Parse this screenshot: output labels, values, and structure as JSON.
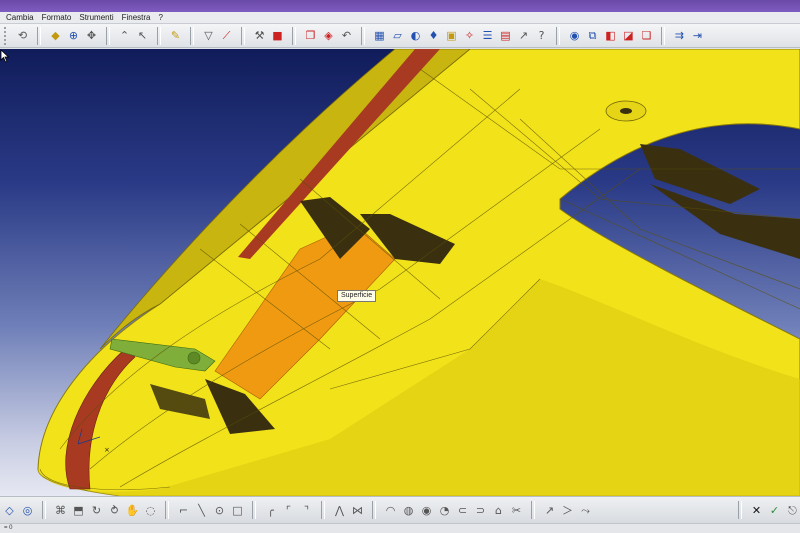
{
  "menu": {
    "items": [
      "Cambia",
      "Formato",
      "Strumenti",
      "Finestra",
      "?"
    ]
  },
  "viewport": {
    "tooltip": "Superficie",
    "colors": {
      "part_surface": "#f2e21a",
      "part_edge": "#b8a810",
      "selected_face": "#f09a12",
      "red_face": "#a83a22",
      "green_face": "#7fae3a",
      "background_top": "#101c5a",
      "background_bottom": "#e6e8f2"
    }
  },
  "status": {
    "text": "= 0"
  },
  "icons": {
    "top_toolbar": [
      "rotate-icon",
      "cube-view-icon",
      "zoom-icon",
      "pan-icon",
      "hand-icon",
      "help-cursor-icon",
      "sketch-icon",
      "filter-icon",
      "line-icon",
      "knife-icon",
      "render-icon",
      "copy-icon",
      "material-icon",
      "undo-icon",
      "grid-icon",
      "plane-icon",
      "render-shade-icon",
      "paint-icon",
      "box-icon",
      "info-icon",
      "layers-icon",
      "picture-icon",
      "pointer-icon",
      "help-icon",
      "camera-icon",
      "window-icon",
      "cube-color-icon",
      "section-icon",
      "duplicate-icon",
      "light-icon",
      "export-icon",
      "exit-icon"
    ],
    "bottom_toolbar": [
      "sketch-plane-icon",
      "shell-icon",
      "constraint-icon",
      "extrude-icon",
      "revolve-icon",
      "sweep-icon",
      "sculpt-icon",
      "point-icon",
      "line-tool-icon",
      "circle-tool-icon",
      "rectangle-tool-icon",
      "arc-tool-icon",
      "fillet-tool-icon",
      "chamfer-tool-icon",
      "measure-icon",
      "dimension-icon",
      "surface-icon",
      "curve-icon",
      "mirror-icon",
      "pattern-icon",
      "trim-icon",
      "extend-icon",
      "snap-icon",
      "split-icon",
      "scissors-icon",
      "arrow-tool-icon",
      "ok-icon",
      "cancel-icon",
      "accept-icon"
    ]
  }
}
